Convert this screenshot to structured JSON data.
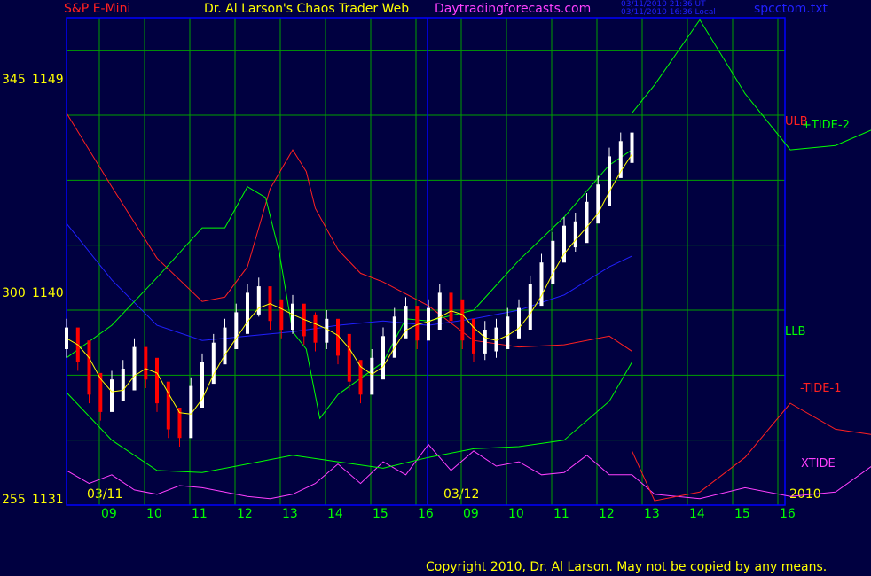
{
  "header": {
    "symbol": "S&P E-Mini",
    "title": "Dr. Al Larson's Chaos Trader Web",
    "site": "Daytradingforecasts.com",
    "time_ut": "03/11/2010 21:36 UT",
    "time_local": "03/11/2010 16:36 Local",
    "file": "spcctom.txt"
  },
  "footer": {
    "copyright": "Copyright 2010, Dr. Al Larson. May not be copied by any means."
  },
  "colors": {
    "background": "#000040",
    "grid": "#00a000",
    "axis": "#0000ff",
    "price_up": "#ffffff",
    "price_down": "#ff0000",
    "avg": "#ffff00",
    "green": "#00ff00",
    "red": "#ff2020",
    "magenta": "#ff40ff",
    "blue": "#2020ff"
  },
  "chart_data": {
    "type": "line",
    "y_labels": [
      {
        "a": "345",
        "b": "1149",
        "price": 1149
      },
      {
        "a": "300",
        "b": "1140",
        "price": 1140
      },
      {
        "a": "255",
        "b": "1131",
        "price": 1131
      }
    ],
    "ylim": [
      1131,
      1153.5
    ],
    "x_tick_labels": [
      "09",
      "10",
      "11",
      "12",
      "13",
      "14",
      "15",
      "16",
      "09",
      "10",
      "11",
      "12",
      "13",
      "14",
      "15",
      "16"
    ],
    "date_labels": [
      "03/11",
      "03/12"
    ],
    "year_label": "2010",
    "series_labels": [
      {
        "name": "ULB",
        "color": "#ff2020"
      },
      {
        "name": "+TIDE-2",
        "color": "#00ff00"
      },
      {
        "name": "LLB",
        "color": "#00ff00"
      },
      {
        "name": "-TIDE-1",
        "color": "#ff2020"
      },
      {
        "name": "XTIDE",
        "color": "#ff40ff"
      }
    ],
    "grid": true,
    "price_bars": [
      [
        0,
        1138.7
      ],
      [
        0.25,
        1138.1
      ],
      [
        0.5,
        1136.6
      ],
      [
        0.75,
        1135.8
      ],
      [
        1,
        1136.3
      ],
      [
        1.25,
        1136.8
      ],
      [
        1.5,
        1137.8
      ],
      [
        1.75,
        1137.3
      ],
      [
        2,
        1136.2
      ],
      [
        2.25,
        1135.0
      ],
      [
        2.5,
        1134.6
      ],
      [
        2.75,
        1136.0
      ],
      [
        3,
        1137.1
      ],
      [
        3.25,
        1138.0
      ],
      [
        3.5,
        1138.7
      ],
      [
        3.75,
        1139.4
      ],
      [
        4,
        1140.3
      ],
      [
        4.25,
        1140.6
      ],
      [
        4.5,
        1140.0
      ],
      [
        4.75,
        1139.6
      ],
      [
        5,
        1139.8
      ],
      [
        5.25,
        1139.3
      ],
      [
        5.5,
        1139.0
      ],
      [
        5.75,
        1139.1
      ],
      [
        6,
        1138.4
      ],
      [
        6.25,
        1137.2
      ],
      [
        6.5,
        1136.6
      ],
      [
        6.75,
        1137.3
      ],
      [
        7,
        1138.3
      ],
      [
        7.25,
        1139.2
      ],
      [
        7.5,
        1139.7
      ],
      [
        7.75,
        1139.1
      ],
      [
        8,
        1139.6
      ],
      [
        8.25,
        1140.3
      ],
      [
        8.5,
        1140.0
      ],
      [
        8.75,
        1139.1
      ],
      [
        9,
        1138.5
      ],
      [
        9.25,
        1138.6
      ],
      [
        9.5,
        1138.7
      ],
      [
        9.75,
        1139.2
      ],
      [
        10,
        1139.6
      ],
      [
        10.25,
        1140.7
      ],
      [
        10.5,
        1141.7
      ],
      [
        10.75,
        1142.7
      ],
      [
        11,
        1143.4
      ],
      [
        11.25,
        1143.6
      ],
      [
        11.5,
        1144.5
      ],
      [
        11.75,
        1145.3
      ],
      [
        12,
        1146.6
      ],
      [
        12.25,
        1147.3
      ],
      [
        12.5,
        1147.7
      ]
    ],
    "series_points": {
      "ULB": [
        [
          0,
          1149.1
        ],
        [
          1,
          1145.7
        ],
        [
          2,
          1142.4
        ],
        [
          3,
          1140.4
        ],
        [
          3.5,
          1140.6
        ],
        [
          4,
          1142.0
        ],
        [
          4.5,
          1145.6
        ],
        [
          5,
          1147.4
        ],
        [
          5.3,
          1146.4
        ],
        [
          5.5,
          1144.7
        ],
        [
          6,
          1142.8
        ],
        [
          6.5,
          1141.7
        ],
        [
          7,
          1141.3
        ],
        [
          8,
          1140.2
        ],
        [
          9,
          1138.6
        ],
        [
          10,
          1138.3
        ],
        [
          11,
          1138.4
        ],
        [
          12,
          1138.8
        ],
        [
          12.5,
          1138.1
        ],
        [
          12.5,
          1133.5
        ],
        [
          13,
          1131.2
        ],
        [
          14,
          1131.6
        ],
        [
          15,
          1133.2
        ],
        [
          16,
          1135.7
        ],
        [
          17,
          1134.5
        ],
        [
          18,
          1134.2
        ],
        [
          19,
          1136.1
        ],
        [
          20,
          1138.0
        ],
        [
          21,
          1138.2
        ],
        [
          22,
          1136.7
        ]
      ],
      "LLB": [
        [
          0,
          1136.2
        ],
        [
          1,
          1134.0
        ],
        [
          2,
          1132.6
        ],
        [
          3,
          1132.5
        ],
        [
          4,
          1132.9
        ],
        [
          5,
          1133.3
        ],
        [
          6,
          1133.0
        ],
        [
          7,
          1132.7
        ],
        [
          8,
          1133.2
        ],
        [
          9,
          1133.6
        ],
        [
          10,
          1133.7
        ],
        [
          11,
          1134.0
        ],
        [
          12,
          1135.8
        ],
        [
          12.5,
          1137.6
        ]
      ],
      "TIDE_2": [
        [
          0,
          1137.8
        ],
        [
          1,
          1139.3
        ],
        [
          2,
          1141.5
        ],
        [
          3,
          1143.8
        ],
        [
          3.5,
          1143.8
        ],
        [
          4,
          1145.7
        ],
        [
          4.4,
          1145.2
        ],
        [
          4.7,
          1142.7
        ],
        [
          5,
          1139.0
        ],
        [
          5.3,
          1138.2
        ],
        [
          5.6,
          1135.0
        ],
        [
          6,
          1136.1
        ],
        [
          7,
          1137.6
        ],
        [
          7.5,
          1139.6
        ],
        [
          8,
          1139.5
        ],
        [
          9,
          1140.0
        ],
        [
          10,
          1142.3
        ],
        [
          11,
          1144.3
        ],
        [
          12,
          1146.7
        ],
        [
          12.5,
          1147.4
        ],
        [
          12.5,
          1149.1
        ],
        [
          13,
          1150.4
        ],
        [
          14,
          1153.4
        ],
        [
          15,
          1150.0
        ],
        [
          16,
          1147.4
        ],
        [
          17,
          1147.6
        ],
        [
          18,
          1148.5
        ],
        [
          19,
          1148.4
        ],
        [
          20,
          1146.7
        ],
        [
          21,
          1145.2
        ],
        [
          22,
          1146.4
        ]
      ],
      "BLUE": [
        [
          0,
          1144.0
        ],
        [
          1,
          1141.4
        ],
        [
          2,
          1139.3
        ],
        [
          3,
          1138.6
        ],
        [
          4,
          1138.8
        ],
        [
          5,
          1139.0
        ],
        [
          6,
          1139.3
        ],
        [
          7,
          1139.5
        ],
        [
          8,
          1139.3
        ],
        [
          9,
          1139.6
        ],
        [
          10,
          1140.0
        ],
        [
          11,
          1140.7
        ],
        [
          12,
          1142.0
        ],
        [
          12.5,
          1142.5
        ]
      ],
      "XTIDE": [
        [
          0,
          1132.6
        ],
        [
          0.5,
          1132.0
        ],
        [
          1,
          1132.4
        ],
        [
          1.5,
          1131.7
        ],
        [
          2,
          1131.5
        ],
        [
          2.5,
          1131.9
        ],
        [
          3,
          1131.8
        ],
        [
          3.5,
          1131.6
        ],
        [
          4,
          1131.4
        ],
        [
          4.5,
          1131.3
        ],
        [
          5,
          1131.5
        ],
        [
          5.5,
          1132.0
        ],
        [
          6,
          1132.9
        ],
        [
          6.5,
          1132.0
        ],
        [
          7,
          1133.0
        ],
        [
          7.5,
          1132.4
        ],
        [
          8,
          1133.8
        ],
        [
          8.5,
          1132.6
        ],
        [
          9,
          1133.5
        ],
        [
          9.5,
          1132.8
        ],
        [
          10,
          1133.0
        ],
        [
          10.5,
          1132.4
        ],
        [
          11,
          1132.5
        ],
        [
          11.5,
          1133.3
        ],
        [
          12,
          1132.4
        ],
        [
          12.5,
          1132.4
        ],
        [
          13,
          1131.5
        ],
        [
          14,
          1131.3
        ],
        [
          15,
          1131.8
        ],
        [
          16,
          1131.4
        ],
        [
          17,
          1131.6
        ],
        [
          18,
          1133.1
        ],
        [
          18.5,
          1133.4
        ],
        [
          19,
          1132.5
        ],
        [
          19.5,
          1131.9
        ],
        [
          20,
          1132.9
        ],
        [
          20.5,
          1132.4
        ],
        [
          21,
          1133.0
        ],
        [
          21.5,
          1132.5
        ],
        [
          22,
          1132.5
        ]
      ]
    }
  }
}
